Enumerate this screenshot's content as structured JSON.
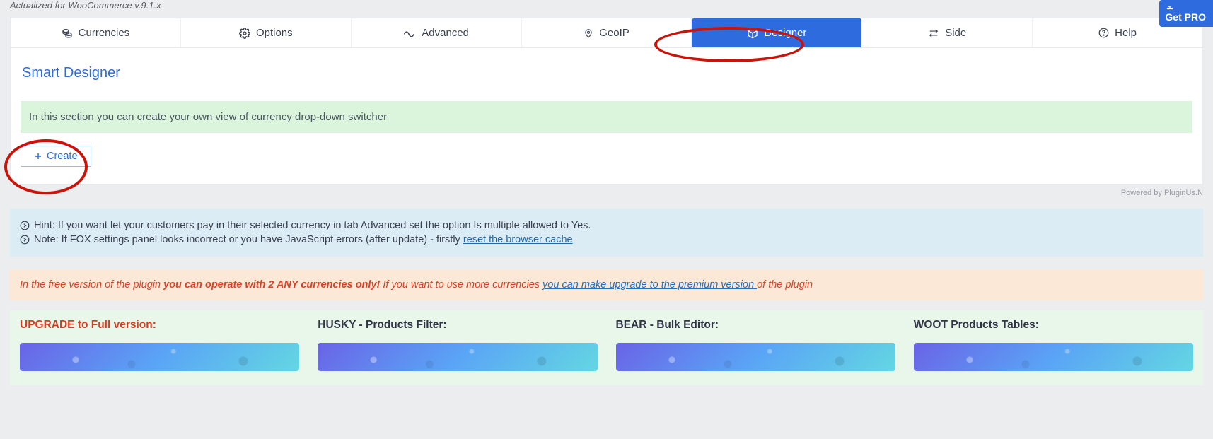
{
  "version_line": "Actualized for WooCommerce v.9.1.x",
  "get_pro": "Get PRO",
  "tabs": {
    "currencies": "Currencies",
    "options": "Options",
    "advanced": "Advanced",
    "geoip": "GeoIP",
    "designer": "Designer",
    "side": "Side",
    "help": "Help"
  },
  "page_title": "Smart Designer",
  "green_msg": "In this section you can create your own view of currency drop-down switcher",
  "create_btn": "Create",
  "powered": "Powered by PluginUs.N",
  "info1": "Hint: If you want let your customers pay in their selected currency in tab Advanced set the option Is multiple allowed to Yes.",
  "info2_a": "Note: If FOX settings panel looks incorrect or you have JavaScript errors (after update) - firstly ",
  "info2_link": "reset the browser cache",
  "warn": {
    "a": "In the free version of the plugin ",
    "b": "you can operate with 2 ANY currencies only!",
    "c": " If you want to use more currencies ",
    "link": "you can make upgrade to the premium version ",
    "d": "of the plugin"
  },
  "promos": {
    "upgrade": "UPGRADE to Full version:",
    "husky": "HUSKY - Products Filter:",
    "bear": "BEAR - Bulk Editor:",
    "woot": "WOOT Products Tables:"
  }
}
